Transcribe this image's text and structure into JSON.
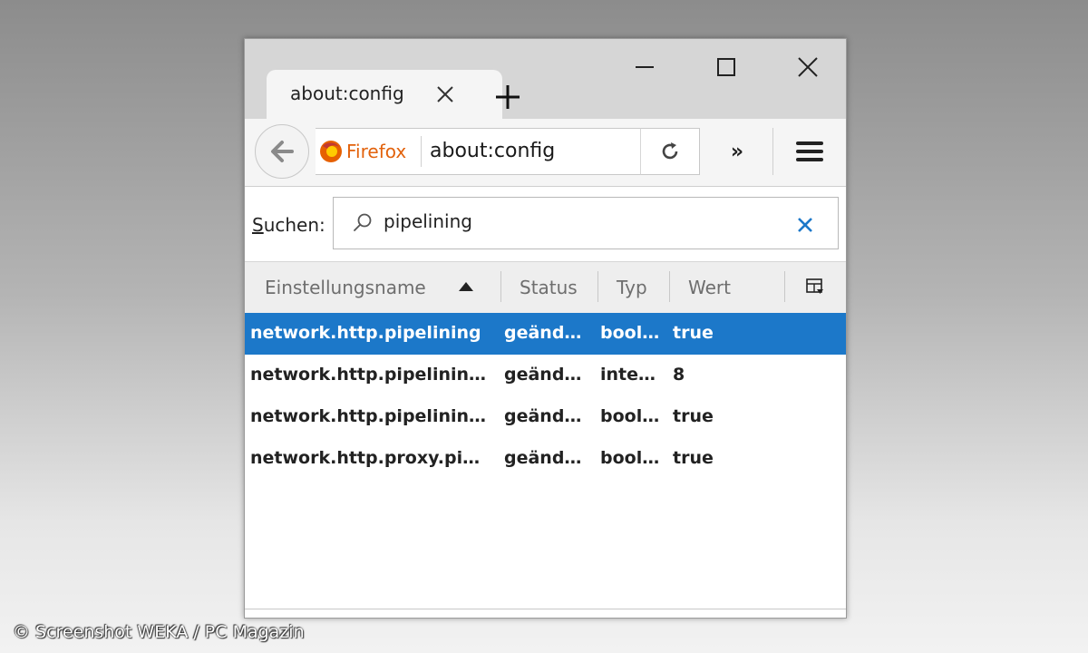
{
  "tab": {
    "title": "about:config"
  },
  "nav": {
    "identity_label": "Firefox",
    "url": "about:config",
    "overflow_label": "»"
  },
  "search": {
    "label_accel": "S",
    "label_rest": "uchen:",
    "value": "pipelining"
  },
  "table": {
    "headers": [
      "Einstellungsname",
      "Status",
      "Typ",
      "Wert"
    ],
    "sort": "ascending",
    "rows": [
      {
        "name": "network.http.pipelining",
        "status": "geänd…",
        "type": "bool…",
        "value": "true",
        "selected": true
      },
      {
        "name": "network.http.pipelinin…",
        "status": "geänd…",
        "type": "inte…",
        "value": "8",
        "selected": false
      },
      {
        "name": "network.http.pipelinin…",
        "status": "geänd…",
        "type": "bool…",
        "value": "true",
        "selected": false
      },
      {
        "name": "network.http.proxy.pi…",
        "status": "geänd…",
        "type": "bool…",
        "value": "true",
        "selected": false
      }
    ]
  },
  "colors": {
    "selection": "#1c78c9",
    "firefox_orange": "#e2620c",
    "clear_blue": "#1c78c9"
  },
  "watermark": "© Screenshot WEKA / PC Magazin"
}
